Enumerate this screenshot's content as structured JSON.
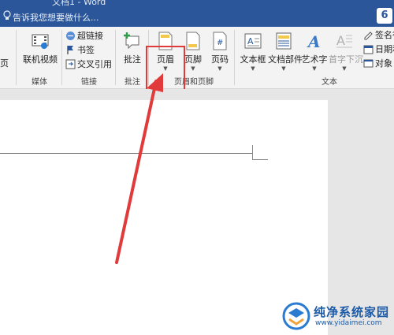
{
  "window": {
    "title_fragment": "文档1 - Word"
  },
  "tellme": {
    "placeholder": "告诉我您想要做什么..."
  },
  "ribbon": {
    "left_cut_label": "页",
    "media": {
      "online_video": "联机视频",
      "group": "媒体"
    },
    "links": {
      "hyperlink": "超链接",
      "bookmark": "书签",
      "cross_reference": "交叉引用",
      "group": "链接"
    },
    "comments": {
      "comment": "批注",
      "group": "批注"
    },
    "header_footer": {
      "header": "页眉",
      "footer": "页脚",
      "page_number": "页码",
      "group": "页眉和页脚"
    },
    "text": {
      "text_box": "文本框",
      "quick_parts": "文档部件",
      "wordart": "艺术字",
      "drop_cap": "首字下沉",
      "signature": "签名行",
      "date_time": "日期和",
      "object": "对象",
      "group": "文本"
    }
  },
  "watermark": {
    "name": "纯净系统家园",
    "url": "www.yidaimei.com"
  },
  "colors": {
    "accent": "#2b579a",
    "highlight": "#e03a3a"
  }
}
